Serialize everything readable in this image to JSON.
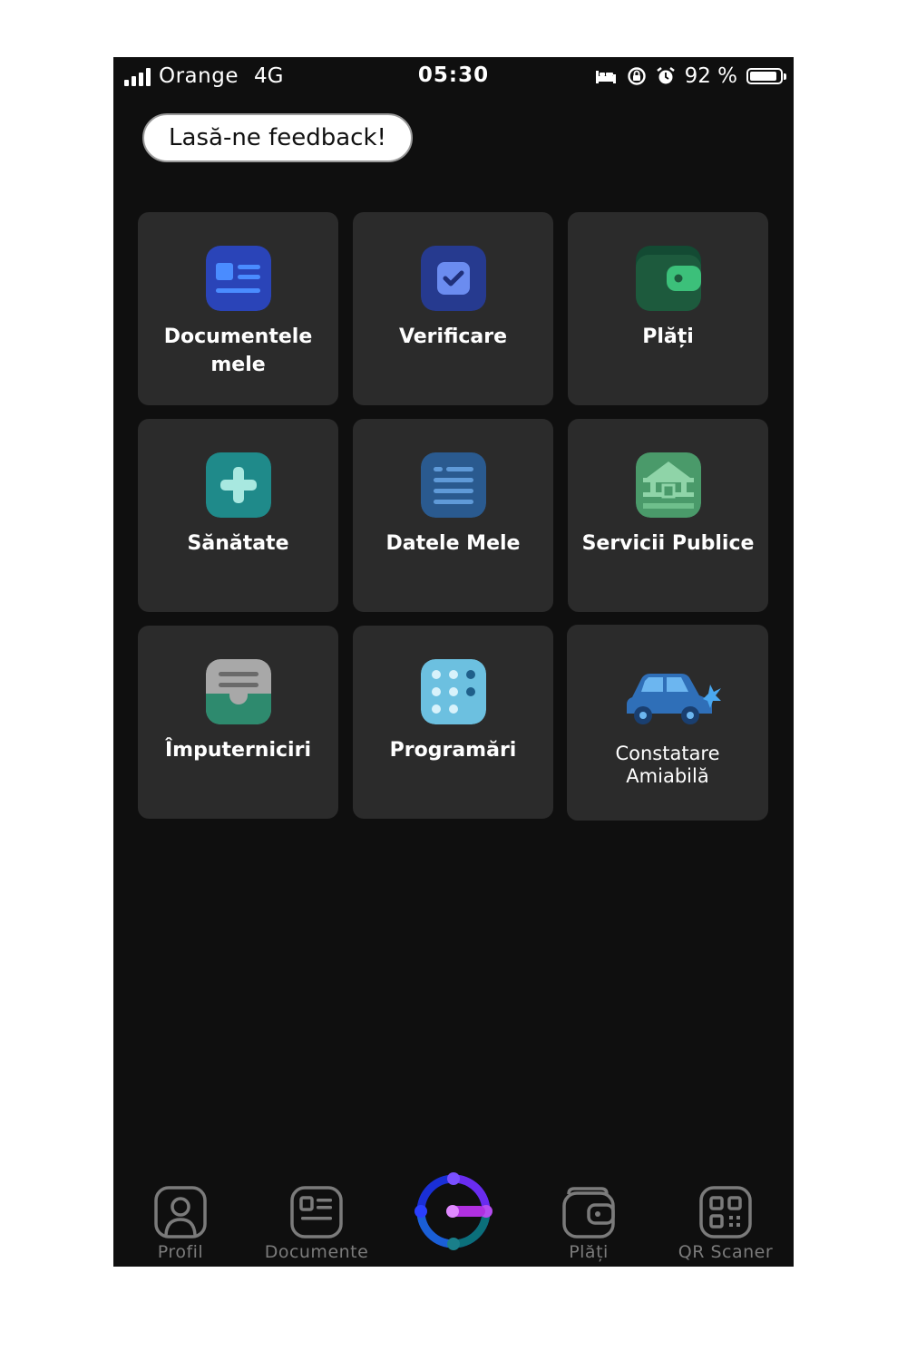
{
  "status_bar": {
    "carrier": "Orange",
    "network": "4G",
    "time": "05:30",
    "battery": "92 %",
    "battery_level": 0.92
  },
  "feedback_label": "Lasă-ne feedback!",
  "tiles": [
    {
      "label": "Documentele mele",
      "icon": "document-card-icon",
      "color": "#2a44b8"
    },
    {
      "label": "Verificare",
      "icon": "checkbox-icon",
      "color": "#263a8f"
    },
    {
      "label": "Plăți",
      "icon": "wallet-icon",
      "color": "#1e5a3c"
    },
    {
      "label": "Sănătate",
      "icon": "medical-cross-icon",
      "color": "#1f8a8a"
    },
    {
      "label": "Datele Mele",
      "icon": "list-icon",
      "color": "#2a5a8f"
    },
    {
      "label": "Servicii Publice",
      "icon": "public-building-icon",
      "color": "#4a9a6a"
    },
    {
      "label": "Împuterniciri",
      "icon": "delegation-icon",
      "color": "#2e8a6e"
    },
    {
      "label": "Programări",
      "icon": "calendar-dots-icon",
      "color": "#6cc0e0"
    },
    {
      "label": "Constatare Amiabilă",
      "icon": "car-crash-icon",
      "color": "#2f6fb8"
    }
  ],
  "tab_bar": [
    {
      "label": "Profil",
      "icon": "profile-icon"
    },
    {
      "label": "Documente",
      "icon": "documents-icon"
    },
    {
      "label": "",
      "icon": "app-logo-icon"
    },
    {
      "label": "Plăți",
      "icon": "wallet-icon"
    },
    {
      "label": "QR Scaner",
      "icon": "qr-code-icon"
    }
  ]
}
